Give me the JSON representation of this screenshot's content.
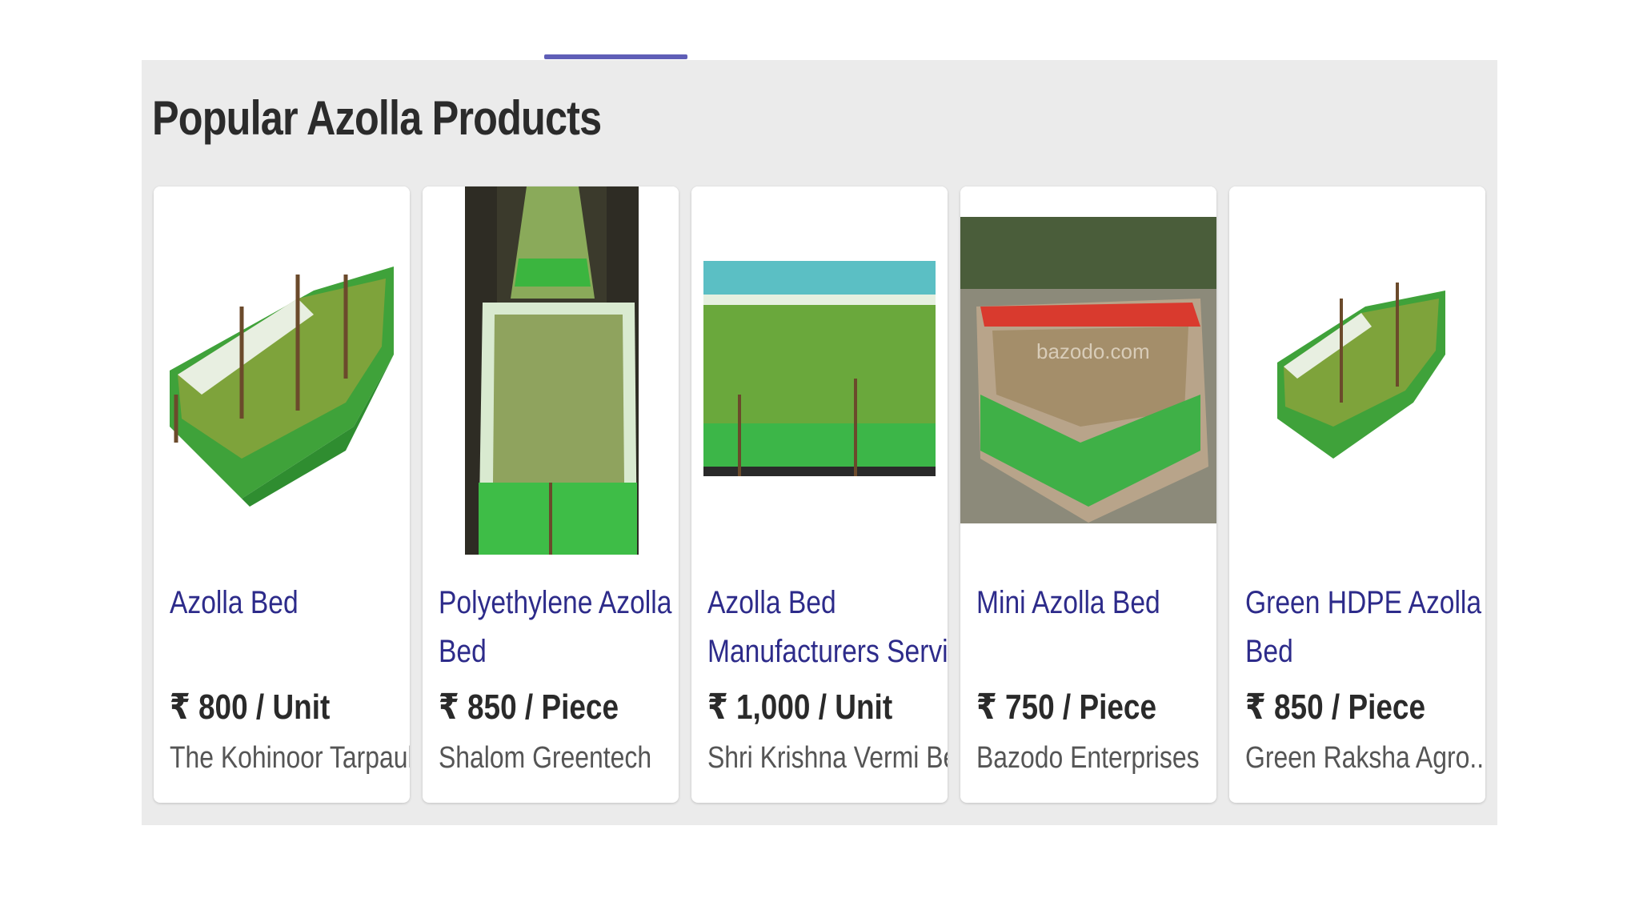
{
  "section": {
    "title": "Popular Azolla Products"
  },
  "products": [
    {
      "name_lines": [
        "Azolla Bed",
        ""
      ],
      "price": "₹ 800 / Unit",
      "seller": "The Kohinoor Tarpauli...",
      "image_desc": "azolla-bed-product-photo"
    },
    {
      "name_lines": [
        "Polyethylene Azolla",
        "Bed"
      ],
      "price": "₹ 850 / Piece",
      "seller": "Shalom Greentech",
      "image_desc": "polyethylene-azolla-bed-photo"
    },
    {
      "name_lines": [
        "Azolla Bed",
        "Manufacturers Service"
      ],
      "price": "₹ 1,000 / Unit",
      "seller": "Shri Krishna Vermi Be...",
      "image_desc": "azolla-bed-service-photo"
    },
    {
      "name_lines": [
        "Mini Azolla Bed",
        ""
      ],
      "price": "₹ 750 / Piece",
      "seller": "Bazodo Enterprises",
      "image_desc": "mini-azolla-bed-photo"
    },
    {
      "name_lines": [
        "Green HDPE Azolla",
        "Bed"
      ],
      "price": "₹ 850 / Piece",
      "seller": "Green Raksha Agro...",
      "image_desc": "green-hdpe-azolla-bed-photo"
    }
  ],
  "watermarks": {
    "card4": "bazodo.com"
  },
  "colors": {
    "accent": "#5f5eb7",
    "link": "#2d2b8a",
    "panel_bg": "#ebebeb"
  }
}
